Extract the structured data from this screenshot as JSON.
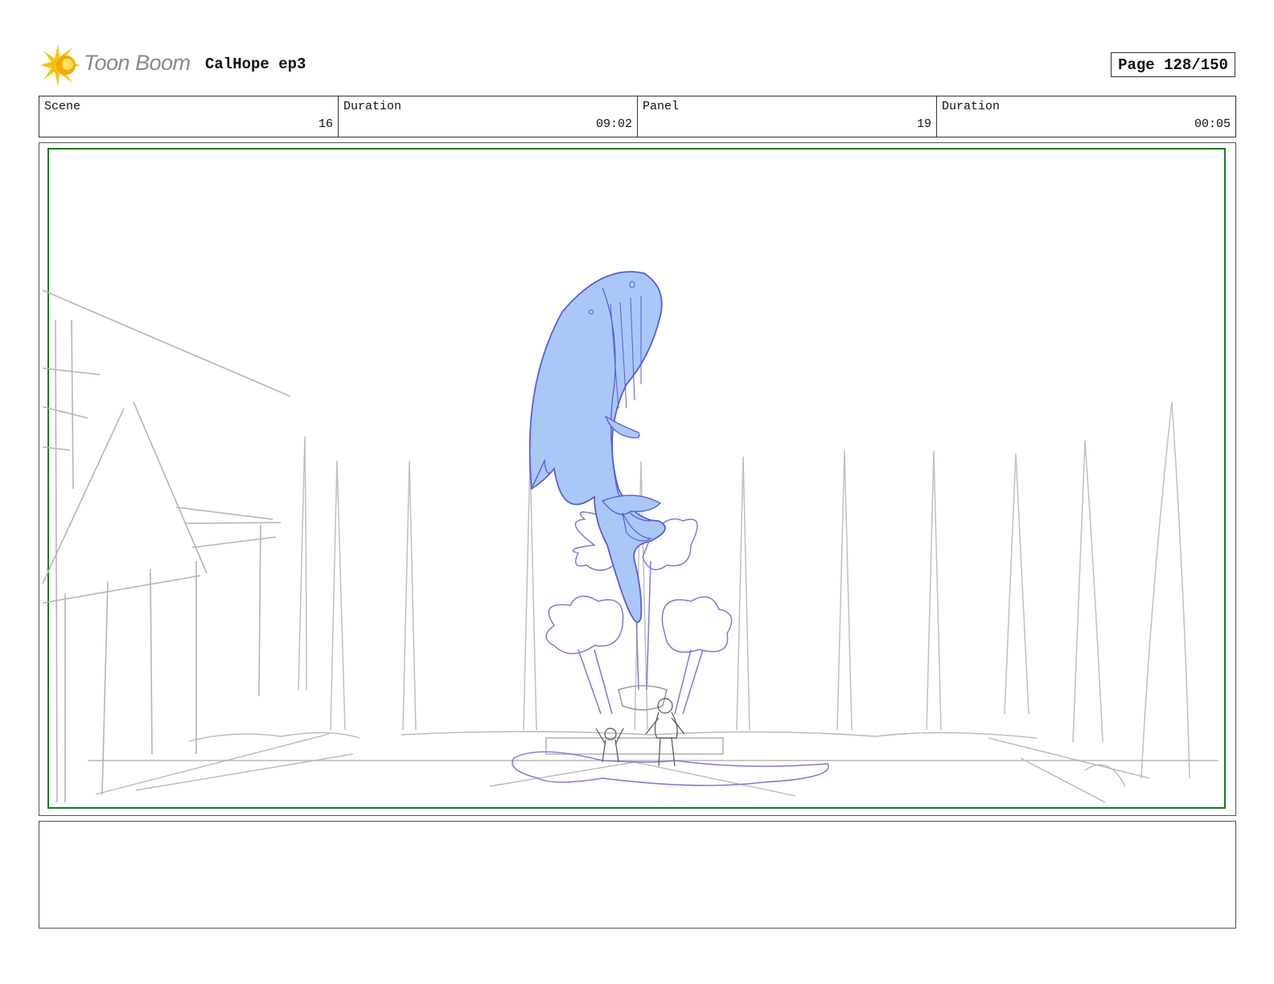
{
  "header": {
    "logo_text": "Toon Boom",
    "logo_icon": "starburst-icon",
    "project_title": "CalHope ep3",
    "page_label": "Page 128/150"
  },
  "info": {
    "scene_label": "Scene",
    "scene_value": "16",
    "scene_duration_label": "Duration",
    "scene_duration_value": "09:02",
    "panel_label": "Panel",
    "panel_value": "19",
    "panel_duration_label": "Duration",
    "panel_duration_value": "00:05"
  },
  "colors": {
    "safe_frame": "#1a7a1a",
    "whale_fill": "#a9c8f7",
    "whale_line": "#5b5be0",
    "sketch": "#b5b5b5",
    "logo_yellow": "#f5c400"
  },
  "notes": {
    "text": ""
  }
}
